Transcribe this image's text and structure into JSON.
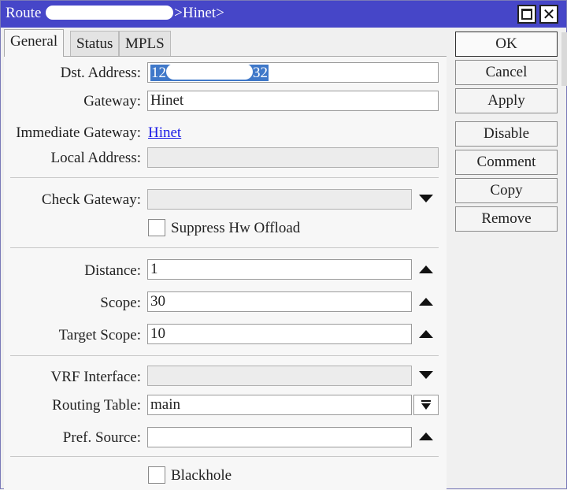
{
  "window": {
    "title_prefix": "Route ",
    "title_suffix": ">Hinet>",
    "maximize_glyph": "",
    "close_glyph": "✕"
  },
  "tabs": [
    {
      "label": "General",
      "active": true
    },
    {
      "label": "Status",
      "active": false
    },
    {
      "label": "MPLS",
      "active": false
    }
  ],
  "form": {
    "dst_address": {
      "label": "Dst. Address:",
      "value_start": "12",
      "value_end": "32"
    },
    "gateway": {
      "label": "Gateway:",
      "value": "Hinet"
    },
    "immediate_gateway": {
      "label": "Immediate Gateway:",
      "value": "Hinet"
    },
    "local_address": {
      "label": "Local Address:",
      "value": ""
    },
    "check_gateway": {
      "label": "Check Gateway:",
      "value": ""
    },
    "suppress_hw_offload": {
      "label": "Suppress Hw Offload",
      "checked": false
    },
    "distance": {
      "label": "Distance:",
      "value": "1"
    },
    "scope": {
      "label": "Scope:",
      "value": "30"
    },
    "target_scope": {
      "label": "Target Scope:",
      "value": "10"
    },
    "vrf_interface": {
      "label": "VRF Interface:",
      "value": ""
    },
    "routing_table": {
      "label": "Routing Table:",
      "value": "main"
    },
    "pref_source": {
      "label": "Pref. Source:",
      "value": ""
    },
    "blackhole": {
      "label": "Blackhole",
      "checked": false
    }
  },
  "buttons": {
    "ok": "OK",
    "cancel": "Cancel",
    "apply": "Apply",
    "disable": "Disable",
    "comment": "Comment",
    "copy": "Copy",
    "remove": "Remove"
  },
  "colors": {
    "titlebar": "#4646c8",
    "selection": "#3f78c9",
    "link": "#1a1ae6"
  }
}
